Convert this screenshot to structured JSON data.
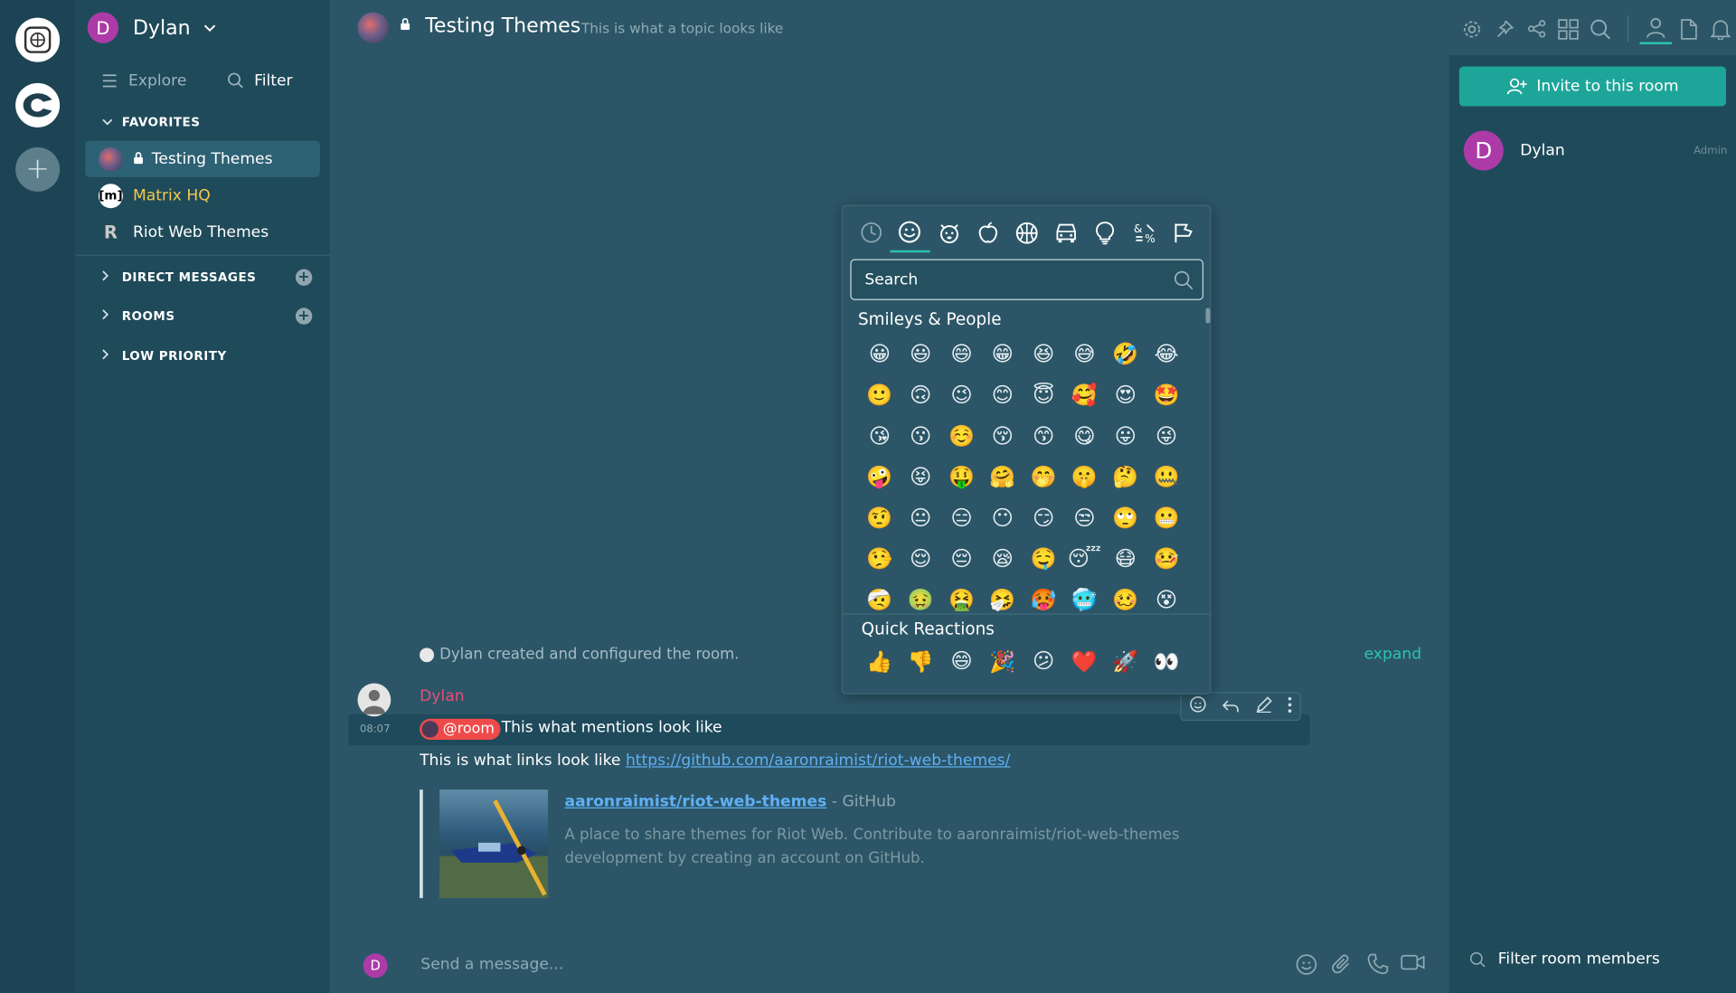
{
  "user": {
    "initial": "D",
    "name": "Dylan"
  },
  "nav": {
    "explore": "Explore",
    "filter": "Filter"
  },
  "sections": {
    "favorites": "FAVORITES",
    "direct_messages": "DIRECT MESSAGES",
    "rooms": "ROOMS",
    "low_priority": "LOW PRIORITY"
  },
  "favorites": [
    {
      "label": "Testing Themes",
      "color": "#ffffff"
    },
    {
      "label": "Matrix HQ",
      "color": "#f2c94c",
      "avatar_letter": "m"
    },
    {
      "label": "Riot Web Themes",
      "color": "#ffffff",
      "avatar_letter": "R"
    }
  ],
  "room": {
    "title": "Testing Themes",
    "topic": "This is what a topic looks like"
  },
  "right_panel": {
    "invite_label": "Invite to this room",
    "member_initial": "D",
    "member_name": "Dylan",
    "member_role": "Admin",
    "filter_label": "Filter room members"
  },
  "timeline": {
    "created_text": "Dylan created and configured the room.",
    "expand": "expand",
    "sender": "Dylan",
    "timestamp": "08:07",
    "mention_pill": "@room",
    "mention_text": "This what mentions look like",
    "links_prefix": "This is what links look like ",
    "link_url": "https://github.com/aaronraimist/riot-web-themes/",
    "preview_title": "aaronraimist/riot-web-themes",
    "preview_site": " - GitHub",
    "preview_desc": "A place to share themes for Riot Web. Contribute to aaronraimist/riot-web-themes development by creating an account on GitHub."
  },
  "composer": {
    "initial": "D",
    "placeholder": "Send a message..."
  },
  "emoji_picker": {
    "search_placeholder": "Search",
    "section_title": "Smileys & People",
    "quick_title": "Quick Reactions",
    "categories": [
      "recent-icon",
      "smiley-icon",
      "animal-icon",
      "food-icon",
      "activity-icon",
      "travel-icon",
      "objects-icon",
      "symbols-icon",
      "flags-icon"
    ],
    "grid": [
      [
        "😀",
        "😃",
        "😄",
        "😁",
        "😆",
        "😅",
        "🤣",
        "😂"
      ],
      [
        "🙂",
        "🙃",
        "😉",
        "😊",
        "😇",
        "🥰",
        "😍",
        "🤩"
      ],
      [
        "😘",
        "😗",
        "☺️",
        "😚",
        "😙",
        "😋",
        "😛",
        "😜"
      ],
      [
        "🤪",
        "😝",
        "🤑",
        "🤗",
        "🤭",
        "🤫",
        "🤔",
        "🤐"
      ],
      [
        "🤨",
        "😐",
        "😑",
        "😶",
        "😏",
        "😒",
        "🙄",
        "😬"
      ],
      [
        "🤥",
        "😌",
        "😔",
        "😪",
        "🤤",
        "😴",
        "😷",
        "🤒"
      ],
      [
        "🤕",
        "🤢",
        "🤮",
        "🤧",
        "🥵",
        "🥶",
        "🥴",
        "😵"
      ]
    ],
    "quick": [
      "👍",
      "👎",
      "😄",
      "🎉",
      "😕",
      "❤️",
      "🚀",
      "👀"
    ]
  },
  "colors": {
    "accent": "#2bc4b0",
    "mention": "#ee4a4a",
    "sender": "#e64f7a",
    "link": "#5fb0f5"
  }
}
